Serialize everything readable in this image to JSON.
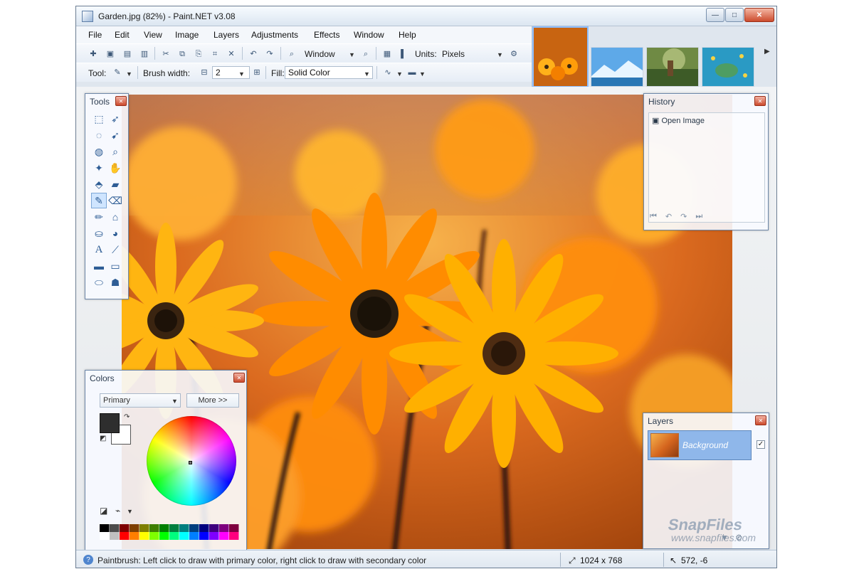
{
  "window": {
    "title": "Garden.jpg (82%) - Paint.NET v3.08"
  },
  "menu": [
    "File",
    "Edit",
    "View",
    "Image",
    "Layers",
    "Adjustments",
    "Effects",
    "Window",
    "Help"
  ],
  "toolbar": {
    "zoom_mode": "Window",
    "units_label": "Units:",
    "units_value": "Pixels",
    "tool_label": "Tool:",
    "brush_width_label": "Brush width:",
    "brush_width_value": "2",
    "fill_label": "Fill:",
    "fill_value": "Solid Color"
  },
  "panels": {
    "tools": {
      "title": "Tools"
    },
    "history": {
      "title": "History",
      "item": "Open Image"
    },
    "colors": {
      "title": "Colors",
      "mode": "Primary",
      "more": "More >>"
    },
    "layers": {
      "title": "Layers",
      "item": "Background"
    }
  },
  "status": {
    "message": "Paintbrush: Left click to draw with primary color, right click to draw with secondary color",
    "size": "1024 x 768",
    "cursor": "572, -6"
  },
  "watermark": {
    "brand": "SnapFiles",
    "url": "www.snapfiles.com"
  },
  "colors": {
    "accent": "#2f6cc5",
    "window_border": "#6b7d92"
  },
  "icons": {
    "menu_doc": "document-icon",
    "tool_brush": "paintbrush-icon"
  }
}
